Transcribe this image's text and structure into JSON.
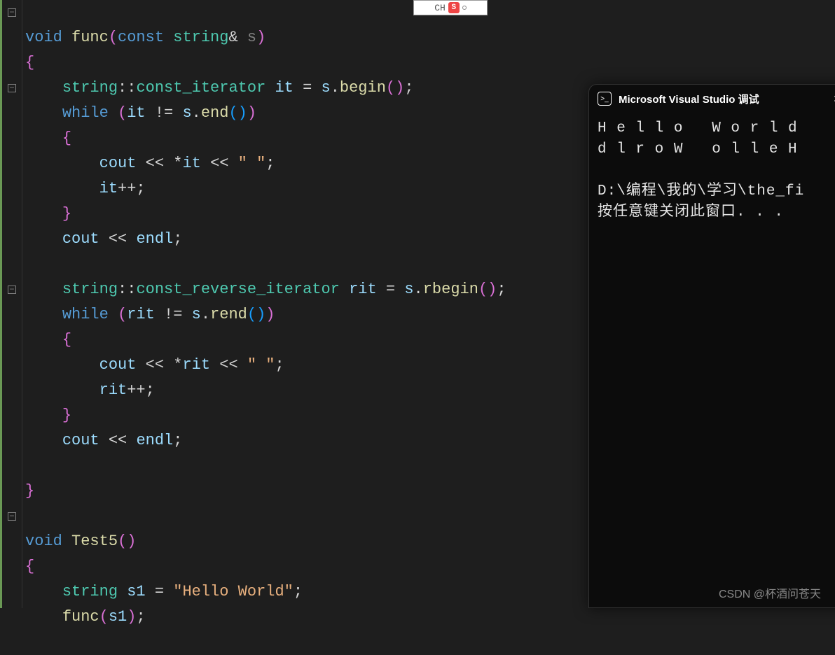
{
  "code": {
    "l1_void": "void",
    "l1_func": "func",
    "l1_const": "const",
    "l1_string": "string",
    "l1_amp": "&",
    "l1_s": "s",
    "l2_brace": "{",
    "l3_ns": "string",
    "l3_iter": "const_iterator",
    "l3_it": "it",
    "l3_s": "s",
    "l3_begin": "begin",
    "l4_while": "while",
    "l4_it": "it",
    "l4_s": "s",
    "l4_end": "end",
    "l5_brace": "{",
    "l6_cout": "cout",
    "l6_it": "it",
    "l6_str": "\" \"",
    "l7_it": "it",
    "l8_brace": "}",
    "l9_cout": "cout",
    "l9_endl": "endl",
    "l11_ns": "string",
    "l11_riter": "const_reverse_iterator",
    "l11_rit": "rit",
    "l11_s": "s",
    "l11_rbegin": "rbegin",
    "l12_while": "while",
    "l12_rit": "rit",
    "l12_s": "s",
    "l12_rend": "rend",
    "l13_brace": "{",
    "l14_cout": "cout",
    "l14_rit": "rit",
    "l14_str": "\" \"",
    "l15_rit": "rit",
    "l16_brace": "}",
    "l17_cout": "cout",
    "l17_endl": "endl",
    "l18_brace": "}",
    "l20_void": "void",
    "l20_test5": "Test5",
    "l21_brace": "{",
    "l22_string": "string",
    "l22_s1": "s1",
    "l22_str": "\"Hello World\"",
    "l23_func": "func",
    "l23_s1": "s1"
  },
  "console": {
    "title": "Microsoft Visual Studio 调试",
    "line1": "H e l l o   W o r l d",
    "line2": "d l r o W   o l l e H",
    "line3": "",
    "line4": "D:\\编程\\我的\\学习\\the_fi",
    "line5": "按任意键关闭此窗口. . ."
  },
  "watermark": "CSDN @杯酒问苍天",
  "ime": "CH"
}
